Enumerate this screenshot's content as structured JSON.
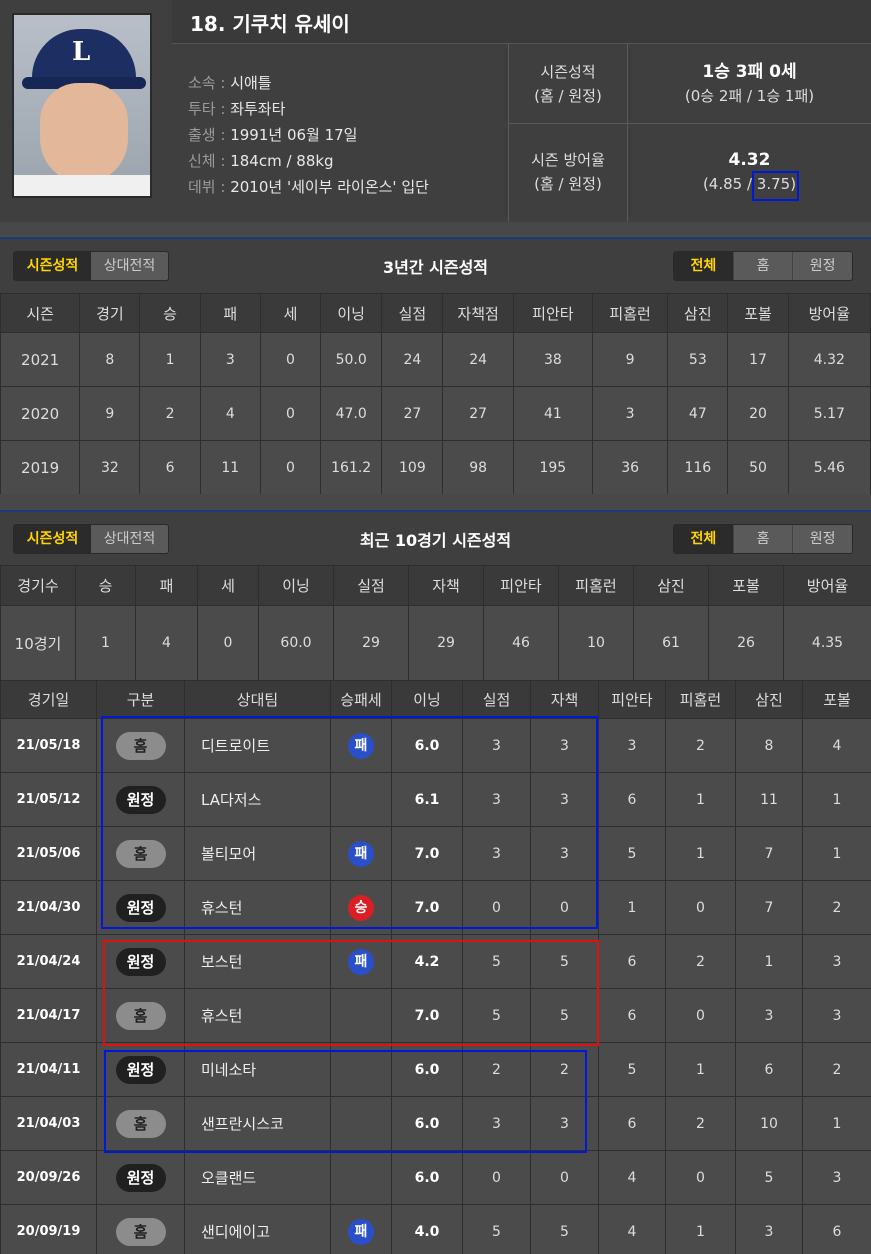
{
  "player": {
    "title": "18. 기쿠치 유세이",
    "info": [
      {
        "k": "소속",
        "v": "시애틀"
      },
      {
        "k": "투타",
        "v": "좌투좌타"
      },
      {
        "k": "출생",
        "v": "1991년 06월 17일"
      },
      {
        "k": "신체",
        "v": "184cm / 88kg"
      },
      {
        "k": "데뷔",
        "v": "2010년 '세이부 라이온스' 입단"
      }
    ],
    "season_record_label1": "시즌성적",
    "season_record_label2": "(홈 / 원정)",
    "season_record_value": "1승 3패 0세",
    "season_record_split": "(0승 2패 / 1승 1패)",
    "era_label1": "시즌 방어율",
    "era_label2": "(홈 / 원정)",
    "era_value": "4.32",
    "era_home": "(4.85 / ",
    "era_away": "3.75",
    "era_close": ")"
  },
  "tabs": {
    "season": "시즌성적",
    "vs": "상대전적",
    "all": "전체",
    "home": "홈",
    "away": "원정"
  },
  "season3": {
    "title": "3년간 시즌성적",
    "headers": [
      "시즌",
      "경기",
      "승",
      "패",
      "세",
      "이닝",
      "실점",
      "자책점",
      "피안타",
      "피홈런",
      "삼진",
      "포볼",
      "방어율"
    ],
    "rows": [
      [
        "2021",
        "8",
        "1",
        "3",
        "0",
        "50.0",
        "24",
        "24",
        "38",
        "9",
        "53",
        "17",
        "4.32"
      ],
      [
        "2020",
        "9",
        "2",
        "4",
        "0",
        "47.0",
        "27",
        "27",
        "41",
        "3",
        "47",
        "20",
        "5.17"
      ],
      [
        "2019",
        "32",
        "6",
        "11",
        "0",
        "161.2",
        "109",
        "98",
        "195",
        "36",
        "116",
        "50",
        "5.46"
      ]
    ]
  },
  "recent": {
    "title": "최근 10경기 시즌성적",
    "sum_headers": [
      "경기수",
      "승",
      "패",
      "세",
      "이닝",
      "실점",
      "자책",
      "피안타",
      "피홈런",
      "삼진",
      "포볼",
      "방어율"
    ],
    "sum_row": [
      "10경기",
      "1",
      "4",
      "0",
      "60.0",
      "29",
      "29",
      "46",
      "10",
      "61",
      "26",
      "4.35"
    ],
    "game_headers": [
      "경기일",
      "구분",
      "상대팀",
      "승패세",
      "이닝",
      "실점",
      "자책",
      "피안타",
      "피홈런",
      "삼진",
      "포볼"
    ],
    "games": [
      {
        "date": "21/05/18",
        "type": "홈",
        "opp": "디트로이트",
        "res": "패",
        "ip": "6.0",
        "r": "3",
        "er": "3",
        "h": "3",
        "hr": "2",
        "so": "8",
        "bb": "4"
      },
      {
        "date": "21/05/12",
        "type": "원정",
        "opp": "LA다저스",
        "res": "",
        "ip": "6.1",
        "r": "3",
        "er": "3",
        "h": "6",
        "hr": "1",
        "so": "11",
        "bb": "1"
      },
      {
        "date": "21/05/06",
        "type": "홈",
        "opp": "볼티모어",
        "res": "패",
        "ip": "7.0",
        "r": "3",
        "er": "3",
        "h": "5",
        "hr": "1",
        "so": "7",
        "bb": "1"
      },
      {
        "date": "21/04/30",
        "type": "원정",
        "opp": "휴스턴",
        "res": "승",
        "ip": "7.0",
        "r": "0",
        "er": "0",
        "h": "1",
        "hr": "0",
        "so": "7",
        "bb": "2"
      },
      {
        "date": "21/04/24",
        "type": "원정",
        "opp": "보스턴",
        "res": "패",
        "ip": "4.2",
        "r": "5",
        "er": "5",
        "h": "6",
        "hr": "2",
        "so": "1",
        "bb": "3"
      },
      {
        "date": "21/04/17",
        "type": "홈",
        "opp": "휴스턴",
        "res": "",
        "ip": "7.0",
        "r": "5",
        "er": "5",
        "h": "6",
        "hr": "0",
        "so": "3",
        "bb": "3"
      },
      {
        "date": "21/04/11",
        "type": "원정",
        "opp": "미네소타",
        "res": "",
        "ip": "6.0",
        "r": "2",
        "er": "2",
        "h": "5",
        "hr": "1",
        "so": "6",
        "bb": "2"
      },
      {
        "date": "21/04/03",
        "type": "홈",
        "opp": "샌프란시스코",
        "res": "",
        "ip": "6.0",
        "r": "3",
        "er": "3",
        "h": "6",
        "hr": "2",
        "so": "10",
        "bb": "1"
      },
      {
        "date": "20/09/26",
        "type": "원정",
        "opp": "오클랜드",
        "res": "",
        "ip": "6.0",
        "r": "0",
        "er": "0",
        "h": "4",
        "hr": "0",
        "so": "5",
        "bb": "3"
      },
      {
        "date": "20/09/19",
        "type": "홈",
        "opp": "샌디에이고",
        "res": "패",
        "ip": "4.0",
        "r": "5",
        "er": "5",
        "h": "4",
        "hr": "1",
        "so": "3",
        "bb": "6"
      }
    ]
  },
  "colors": {
    "highlight_blue": "#0018d8",
    "highlight_red": "#e01010",
    "tab_active_text": "#ffd400",
    "win": "#d81f26",
    "lose": "#2950c9"
  }
}
